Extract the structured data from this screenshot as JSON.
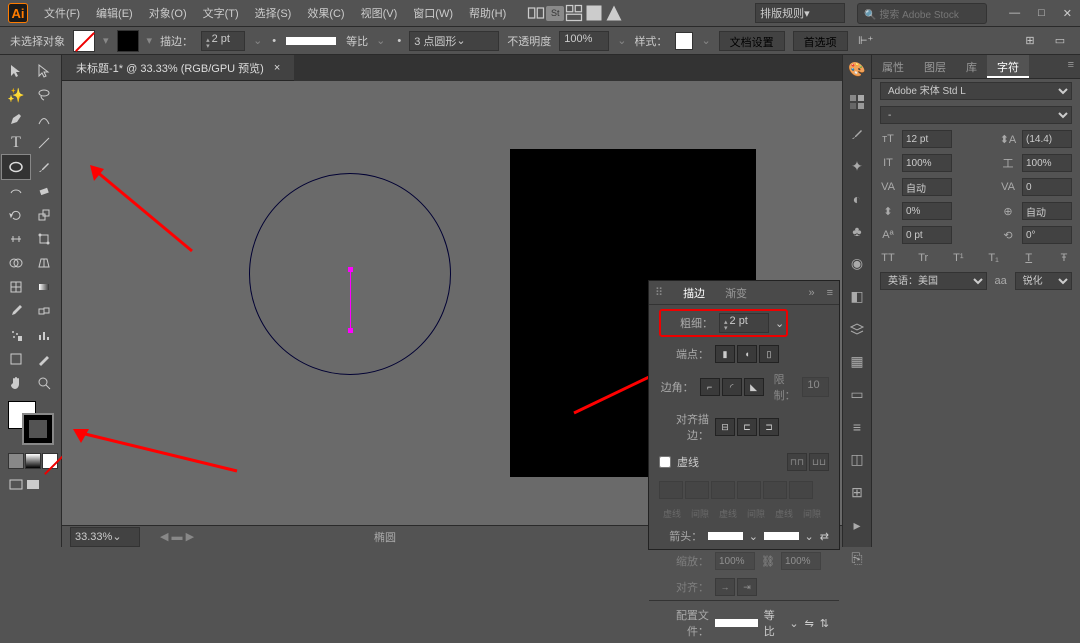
{
  "app": {
    "logo": "Ai",
    "layout_preset": "排版规则",
    "search_placeholder": "搜索 Adobe Stock"
  },
  "menu": {
    "file": "文件(F)",
    "edit": "编辑(E)",
    "object": "对象(O)",
    "type": "文字(T)",
    "select": "选择(S)",
    "effect": "效果(C)",
    "view": "视图(V)",
    "window": "窗口(W)",
    "help": "帮助(H)"
  },
  "options": {
    "no_selection": "未选择对象",
    "stroke_label": "描边：",
    "stroke_value": "2 pt",
    "uniform": "等比",
    "dash_style": "3 点圆形",
    "opacity_label": "不透明度",
    "opacity_value": "100%",
    "style_label": "样式：",
    "doc_setup": "文档设置",
    "prefs": "首选项"
  },
  "doc": {
    "tab_title": "未标题-1* @ 33.33% (RGB/GPU 预览)"
  },
  "status": {
    "zoom": "33.33%",
    "tool_name": "椭圆"
  },
  "char_panel": {
    "tabs": {
      "properties": "属性",
      "layers": "图层",
      "libraries": "库",
      "character": "字符"
    },
    "font": "Adobe 宋体 Std L",
    "style": "-",
    "size": "12 pt",
    "leading": "(14.4)",
    "tracking_v": "100%",
    "tracking_h": "100%",
    "kerning": "自动",
    "metrics": "0",
    "vscale": "0%",
    "baseline": "自动",
    "shift": "0 pt",
    "rotate": "0°",
    "caps": {
      "tt": "TT",
      "tr": "Tr",
      "t1": "T¹",
      "t2": "T₁",
      "t3": "T",
      "tstrike": "Ŧ"
    },
    "lang_label": "英语：美国",
    "aa": "锐化"
  },
  "stroke_panel": {
    "tabs": {
      "stroke": "描边",
      "gradient": "渐变"
    },
    "weight_label": "粗细：",
    "weight_value": "2 pt",
    "cap_label": "端点：",
    "corner_label": "边角：",
    "limit_label": "限制：",
    "limit_value": "10",
    "align_label": "对齐描边：",
    "dashed": "虚线",
    "dash_labels": {
      "d1": "虚线",
      "g1": "间隙",
      "d2": "虚线",
      "g2": "间隙",
      "d3": "虚线",
      "g3": "间隙"
    },
    "arrow_label": "箭头：",
    "scale_label": "缩放：",
    "scale_val": "100%",
    "align_arrow": "对齐：",
    "profile_label": "配置文件：",
    "profile_val": "等比"
  }
}
